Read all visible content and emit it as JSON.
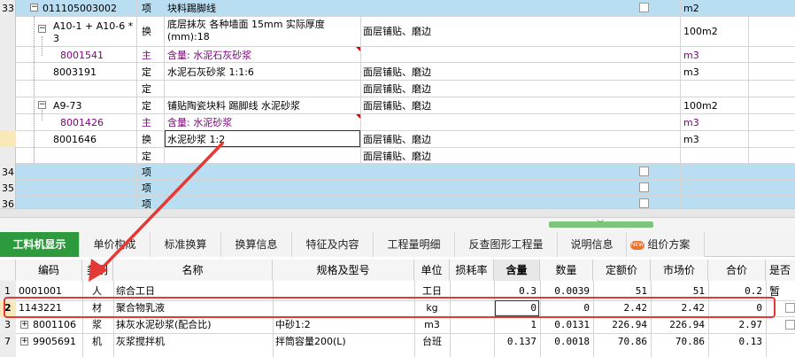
{
  "upper_rows": [
    {
      "no": "33",
      "code": "011105003002",
      "cat": "项",
      "name": "块料踢脚线",
      "spec": "",
      "unit": "m2"
    },
    {
      "no": "",
      "code": "A10-1 + A10-6 * 3",
      "cat": "换",
      "name": "底层抹灰 各种墙面 15mm  实际厚度(mm):18",
      "spec": "面层铺贴、磨边",
      "unit": "100m2"
    },
    {
      "no": "",
      "code": "8001541",
      "cat": "主",
      "name": "含量: 水泥石灰砂浆",
      "spec": "",
      "unit": "m3"
    },
    {
      "no": "",
      "code": "8003191",
      "cat": "定",
      "name": "水泥石灰砂浆 1:1:6",
      "spec": "面层铺贴、磨边",
      "unit": "m3"
    },
    {
      "no": "",
      "code": "",
      "cat": "定",
      "name": "",
      "spec": "面层铺贴、磨边",
      "unit": ""
    },
    {
      "no": "",
      "code": "A9-73",
      "cat": "定",
      "name": "铺贴陶瓷块料 踢脚线 水泥砂浆",
      "spec": "面层铺贴、磨边",
      "unit": "100m2"
    },
    {
      "no": "",
      "code": "8001426",
      "cat": "主",
      "name": "含量: 水泥砂浆",
      "spec": "",
      "unit": "m3"
    },
    {
      "no": "",
      "code": "8001646",
      "cat": "换",
      "name": "水泥砂浆 1:2",
      "spec": "面层铺贴、磨边",
      "unit": "m3"
    },
    {
      "no": "",
      "code": "",
      "cat": "定",
      "name": "",
      "spec": "面层铺贴、磨边",
      "unit": ""
    },
    {
      "no": "34",
      "code": "",
      "cat": "项",
      "name": "",
      "spec": "",
      "unit": ""
    },
    {
      "no": "35",
      "code": "",
      "cat": "项",
      "name": "",
      "spec": "",
      "unit": ""
    },
    {
      "no": "36",
      "code": "",
      "cat": "项",
      "name": "",
      "spec": "",
      "unit": ""
    }
  ],
  "tabs": [
    "工料机显示",
    "单价构成",
    "标准换算",
    "换算信息",
    "特征及内容",
    "工程量明细",
    "反查图形工程量",
    "说明信息",
    "组价方案"
  ],
  "new_badge": "NEW",
  "columns": [
    "编码",
    "类别",
    "名称",
    "规格及型号",
    "单位",
    "损耗率",
    "含量",
    "数量",
    "定额价",
    "市场价",
    "合价",
    "是否暂"
  ],
  "lower_rows": [
    {
      "no": "1",
      "code": "0001001",
      "cat": "人",
      "name": "综合工日",
      "spec": "",
      "unit": "工日",
      "loss": "",
      "qty_content": "0.3",
      "qty": "0.0039",
      "quota": "51",
      "market": "51",
      "total": "0.2"
    },
    {
      "no": "2",
      "code": "1143221",
      "cat": "材",
      "name": "聚合物乳液",
      "spec": "",
      "unit": "kg",
      "loss": "",
      "qty_content": "0",
      "qty": "0",
      "quota": "2.42",
      "market": "2.42",
      "total": "0"
    },
    {
      "no": "3",
      "code": "8001106",
      "cat": "浆",
      "name": "抹灰水泥砂浆(配合比)",
      "spec": "中砂1:2",
      "unit": "m3",
      "loss": "",
      "qty_content": "1",
      "qty": "0.0131",
      "quota": "226.94",
      "market": "226.94",
      "total": "2.97"
    },
    {
      "no": "7",
      "code": "9905691",
      "cat": "机",
      "name": "灰浆搅拌机",
      "spec": "拌筒容量200(L)",
      "unit": "台班",
      "loss": "",
      "qty_content": "0.137",
      "qty": "0.0018",
      "quota": "70.86",
      "market": "70.86",
      "total": "0.13"
    }
  ],
  "colors": {
    "highlight_row": "#b9def2",
    "active_tab": "#2e9a3e",
    "annotation": "#e53935",
    "purple_text": "#800080"
  }
}
